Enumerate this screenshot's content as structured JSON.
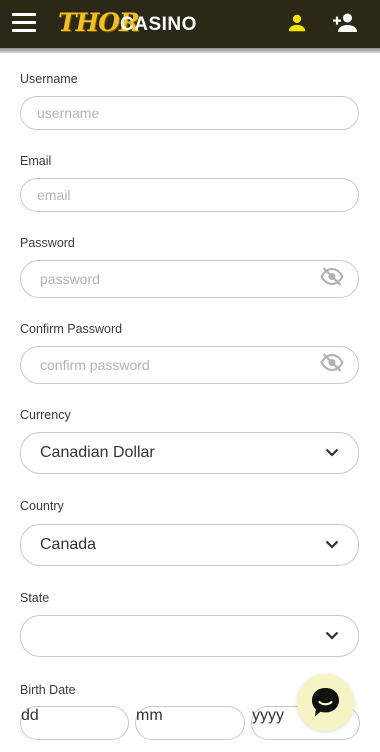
{
  "header": {
    "logo_primary": "THOR",
    "logo_secondary": "CASINO",
    "background": "#2b2818",
    "icon_color": "#f7e500",
    "icons": [
      "menu-icon",
      "user-icon",
      "add-user-icon"
    ]
  },
  "form": {
    "username": {
      "label": "Username",
      "placeholder": "username",
      "value": ""
    },
    "email": {
      "label": "Email",
      "placeholder": "email",
      "value": ""
    },
    "password": {
      "label": "Password",
      "placeholder": "password",
      "value": ""
    },
    "confirm_password": {
      "label": "Confirm Password",
      "placeholder": "confirm password",
      "value": ""
    },
    "currency": {
      "label": "Currency",
      "value": "Canadian Dollar"
    },
    "country": {
      "label": "Country",
      "value": "Canada"
    },
    "state": {
      "label": "State",
      "value": ""
    },
    "birth_date": {
      "label": "Birth Date",
      "day_placeholder": "dd",
      "month_placeholder": "mm",
      "year_placeholder": "yyyy"
    }
  },
  "chat_widget": {
    "icon": "chat-bubble-icon",
    "background": "#f5f4c4"
  }
}
